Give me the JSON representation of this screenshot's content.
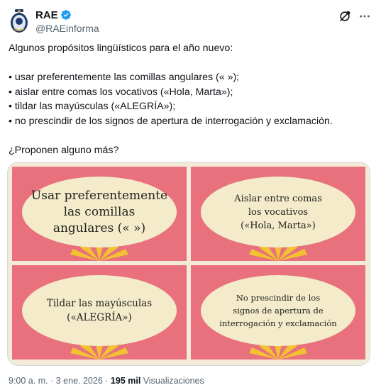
{
  "author": {
    "name": "RAE",
    "handle": "@RAEinforma"
  },
  "post": {
    "lines": [
      "Algunos propósitos lingüísticos para el año nuevo:",
      "",
      "• usar preferentemente las comillas angulares (« »);",
      "• aislar entre comas los vocativos («Hola, Marta»);",
      "• tildar las mayúsculas («ALEGRÍA»);",
      "• no prescindir de los signos de apertura de interrogación y exclamación.",
      "",
      "¿Proponen alguno más?"
    ]
  },
  "media": {
    "cards": [
      {
        "lines": [
          "Usar preferentemente",
          "las comillas",
          "angulares (« »)"
        ]
      },
      {
        "lines": [
          "Aislar entre comas",
          "los vocativos",
          "(«Hola, Marta»)"
        ]
      },
      {
        "lines": [
          "Tildar las mayúsculas",
          "(«ALEGRÍA»)"
        ]
      },
      {
        "lines": [
          "No prescindir de los",
          "signos de apertura de",
          "interrogación y exclamación"
        ]
      }
    ],
    "colors": {
      "card_background": "#e8717d",
      "oval": "#f3ebc9",
      "sun": "#f2c232"
    }
  },
  "footer": {
    "time": "9:00 a. m.",
    "separator": "·",
    "date": "3 ene. 2026",
    "views_count": "195 mil",
    "views_label": "Visualizaciones"
  },
  "icons": [
    "rae-logo-icon",
    "verified-badge-icon",
    "grok-icon",
    "more-icon"
  ]
}
